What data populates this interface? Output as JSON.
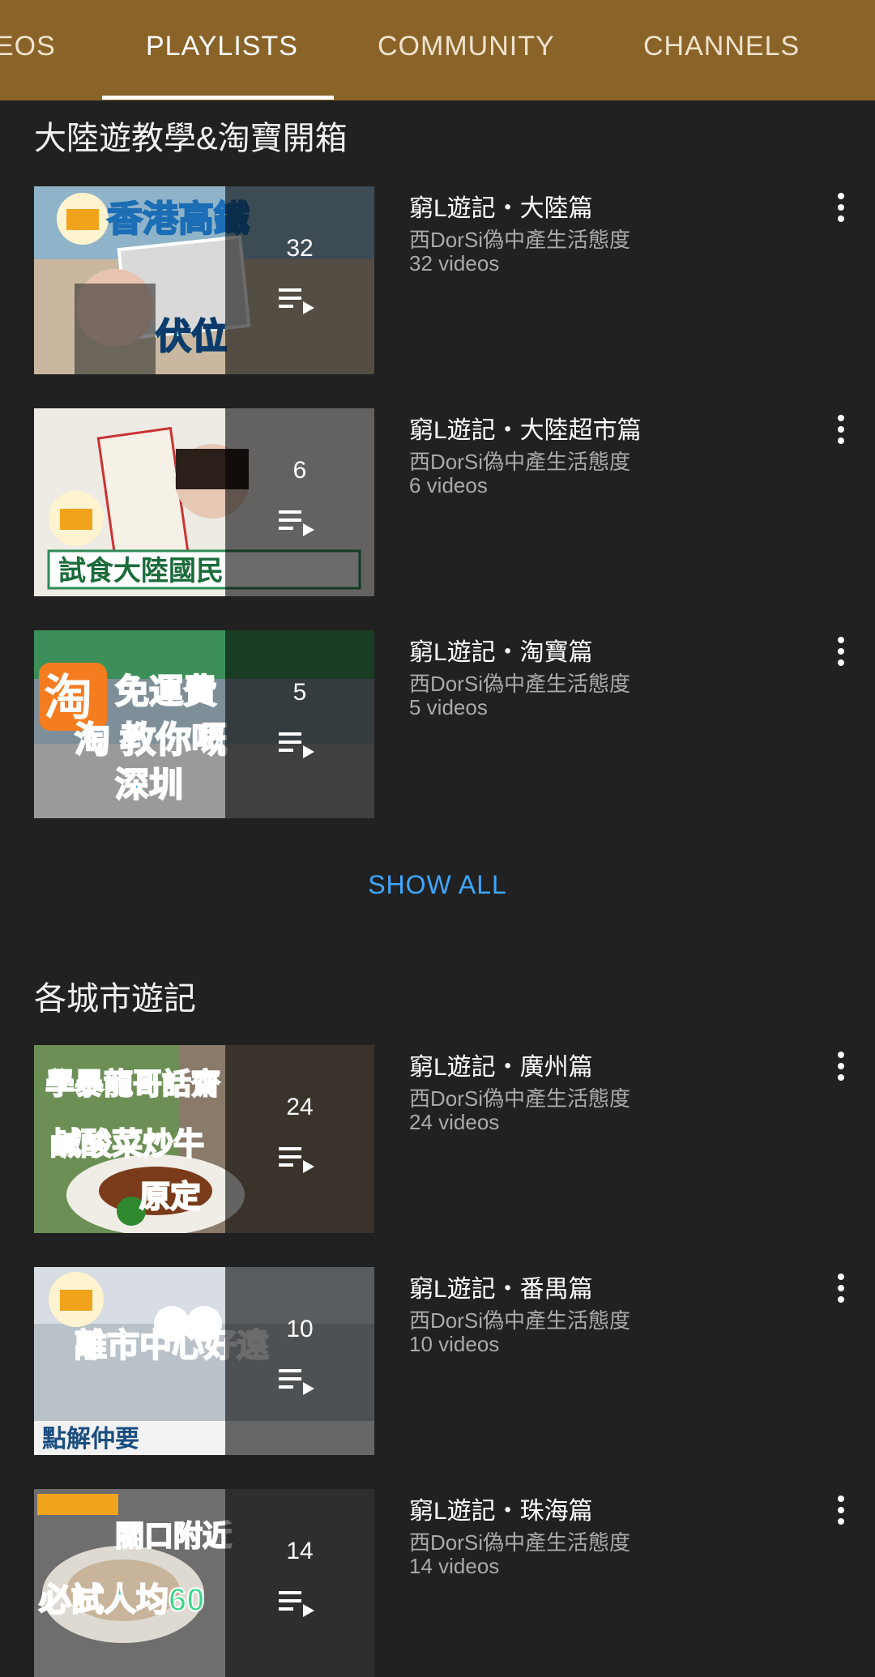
{
  "tabs": [
    {
      "label": "EOS",
      "active": false
    },
    {
      "label": "PLAYLISTS",
      "active": true
    },
    {
      "label": "COMMUNITY",
      "active": false
    },
    {
      "label": "CHANNELS",
      "active": false
    }
  ],
  "sections": [
    {
      "title": "大陸遊教學&淘寶開箱",
      "show_all_label": "SHOW ALL",
      "playlists": [
        {
          "title": "窮L遊記・大陸篇",
          "channel": "西DorSi偽中產生活態度",
          "videos": "32 videos",
          "count": "32",
          "thumb_text": "香港高鐵"
        },
        {
          "title": "窮L遊記・大陸超市篇",
          "channel": "西DorSi偽中產生活態度",
          "videos": "6 videos",
          "count": "6",
          "thumb_text": "試食大陸國民"
        },
        {
          "title": "窮L遊記・淘寶篇",
          "channel": "西DorSi偽中產生活態度",
          "videos": "5 videos",
          "count": "5",
          "thumb_text": "淘 教你嘅"
        }
      ]
    },
    {
      "title": "各城市遊記",
      "playlists": [
        {
          "title": "窮L遊記・廣州篇",
          "channel": "西DorSi偽中產生活態度",
          "videos": "24 videos",
          "count": "24",
          "thumb_text": "學暴龍哥話齋"
        },
        {
          "title": "窮L遊記・番禺篇",
          "channel": "西DorSi偽中產生活態度",
          "videos": "10 videos",
          "count": "10",
          "thumb_text": "離市中心好遠"
        },
        {
          "title": "窮L遊記・珠海篇",
          "channel": "西DorSi偽中產生活態度",
          "videos": "14 videos",
          "count": "14",
          "thumb_text": "必試人均60"
        }
      ]
    }
  ],
  "icons": {
    "playlist": "playlist-play-icon",
    "menu": "more-vert-icon"
  },
  "colors": {
    "tabbar": "#8a6328",
    "background": "#212121",
    "link": "#3ea6ff"
  }
}
